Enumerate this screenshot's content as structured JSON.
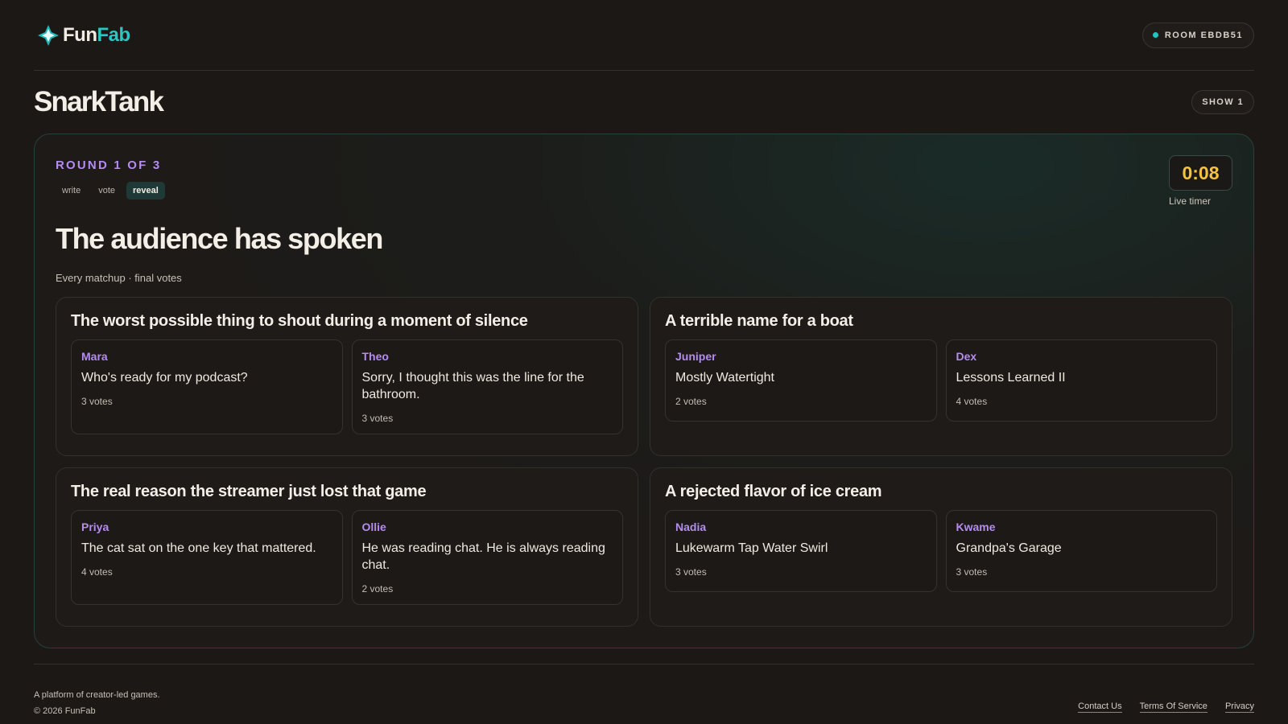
{
  "header": {
    "logo_part1": "Fun",
    "logo_part2": "Fab",
    "room_label": "ROOM EBDB51"
  },
  "game": {
    "title": "SnarkTank",
    "show_label": "SHOW 1"
  },
  "round": {
    "label": "ROUND 1 OF 3",
    "phases": [
      {
        "label": "write",
        "active": false
      },
      {
        "label": "vote",
        "active": false
      },
      {
        "label": "reveal",
        "active": true
      }
    ],
    "timer": "0:08",
    "timer_caption": "Live timer",
    "headline": "The audience has spoken",
    "subline": "Every matchup · final votes"
  },
  "matchups": [
    {
      "prompt": "The worst possible thing to shout during a moment of silence",
      "answers": [
        {
          "player": "Mara",
          "text": "Who's ready for my podcast?",
          "votes": "3 votes"
        },
        {
          "player": "Theo",
          "text": "Sorry, I thought this was the line for the bathroom.",
          "votes": "3 votes"
        }
      ]
    },
    {
      "prompt": "A terrible name for a boat",
      "answers": [
        {
          "player": "Juniper",
          "text": "Mostly Watertight",
          "votes": "2 votes"
        },
        {
          "player": "Dex",
          "text": "Lessons Learned II",
          "votes": "4 votes"
        }
      ]
    },
    {
      "prompt": "The real reason the streamer just lost that game",
      "answers": [
        {
          "player": "Priya",
          "text": "The cat sat on the one key that mattered.",
          "votes": "4 votes"
        },
        {
          "player": "Ollie",
          "text": "He was reading chat. He is always reading chat.",
          "votes": "2 votes"
        }
      ]
    },
    {
      "prompt": "A rejected flavor of ice cream",
      "answers": [
        {
          "player": "Nadia",
          "text": "Lukewarm Tap Water Swirl",
          "votes": "3 votes"
        },
        {
          "player": "Kwame",
          "text": "Grandpa's Garage",
          "votes": "3 votes"
        }
      ]
    }
  ],
  "footer": {
    "tagline": "A platform of creator-led games.",
    "copyright": "© 2026 FunFab",
    "links": [
      "Contact Us",
      "Terms Of Service",
      "Privacy"
    ]
  },
  "colors": {
    "accent_teal": "#2ec4c4",
    "accent_purple": "#b58cf0",
    "timer_yellow": "#f4c23e",
    "background": "#1b1816"
  }
}
